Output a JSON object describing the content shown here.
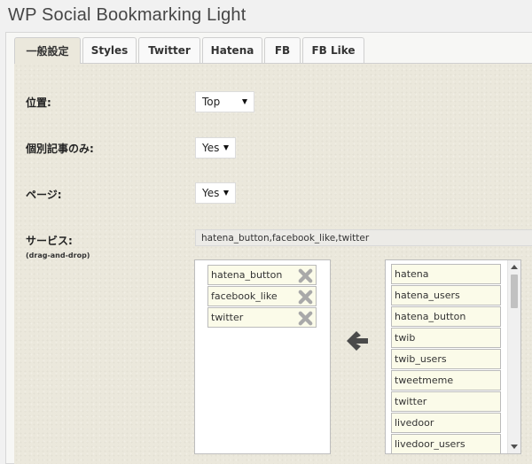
{
  "page": {
    "title": "WP Social Bookmarking Light"
  },
  "tabs": [
    {
      "label": "一般設定",
      "active": true
    },
    {
      "label": "Styles"
    },
    {
      "label": "Twitter"
    },
    {
      "label": "Hatena"
    },
    {
      "label": "FB"
    },
    {
      "label": "FB Like"
    }
  ],
  "settings": {
    "position": {
      "label": "位置:",
      "value": "Top"
    },
    "single_only": {
      "label": "個別記事のみ:",
      "value": "Yes"
    },
    "page": {
      "label": "ページ:",
      "value": "Yes"
    },
    "services": {
      "label": "サービス:",
      "sublabel": "(drag-and-drop)",
      "value": "hatena_button,facebook_like,twitter",
      "selected": [
        "hatena_button",
        "facebook_like",
        "twitter"
      ],
      "available": [
        "hatena",
        "hatena_users",
        "hatena_button",
        "twib",
        "twib_users",
        "tweetmeme",
        "twitter",
        "livedoor",
        "livedoor_users"
      ]
    }
  },
  "icons": {
    "remove": "x-remove-icon",
    "move": "arrow-left-icon"
  },
  "colors": {
    "content_bg": "#ebe8dc",
    "item_bg": "#fbfbe9",
    "icon_gray": "#a9a9a9",
    "arrow_dark": "#4a4a4a"
  }
}
